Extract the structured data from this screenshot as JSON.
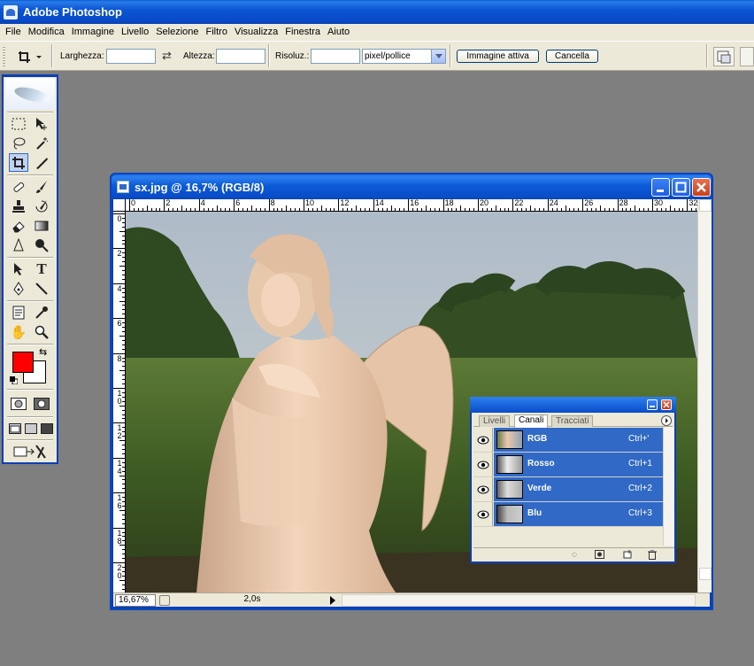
{
  "app": {
    "title": "Adobe Photoshop"
  },
  "menu": [
    "File",
    "Modifica",
    "Immagine",
    "Livello",
    "Selezione",
    "Filtro",
    "Visualizza",
    "Finestra",
    "Aiuto"
  ],
  "options": {
    "width_label": "Larghezza:",
    "width_value": "",
    "height_label": "Altezza:",
    "height_value": "",
    "resolution_label": "Risoluz.:",
    "resolution_value": "",
    "unit_selected": "pixel/pollice",
    "front_image_button": "Immagine attiva",
    "clear_button": "Cancella"
  },
  "document": {
    "title": "sx.jpg @ 16,7% (RGB/8)",
    "zoom": "16,67%",
    "info": "2,0s",
    "ruler_h": [
      "0",
      "2",
      "4",
      "6",
      "8",
      "10",
      "12",
      "14",
      "16",
      "18",
      "20",
      "22",
      "24",
      "26",
      "28",
      "30",
      "32"
    ],
    "ruler_v": [
      "0",
      "2",
      "4",
      "6",
      "8",
      "10",
      "12",
      "14",
      "16",
      "18",
      "20"
    ]
  },
  "panel": {
    "tabs": [
      "Livelli",
      "Canali",
      "Tracciati"
    ],
    "active_tab": "Canali",
    "channels": [
      {
        "name": "RGB",
        "shortcut": "Ctrl+'"
      },
      {
        "name": "Rosso",
        "shortcut": "Ctrl+1"
      },
      {
        "name": "Verde",
        "shortcut": "Ctrl+2"
      },
      {
        "name": "Blu",
        "shortcut": "Ctrl+3"
      }
    ]
  },
  "colors": {
    "foreground": "#ff0000",
    "background": "#ffffff",
    "selection": "#3169c6",
    "titlebar": "#0a4cc9"
  }
}
